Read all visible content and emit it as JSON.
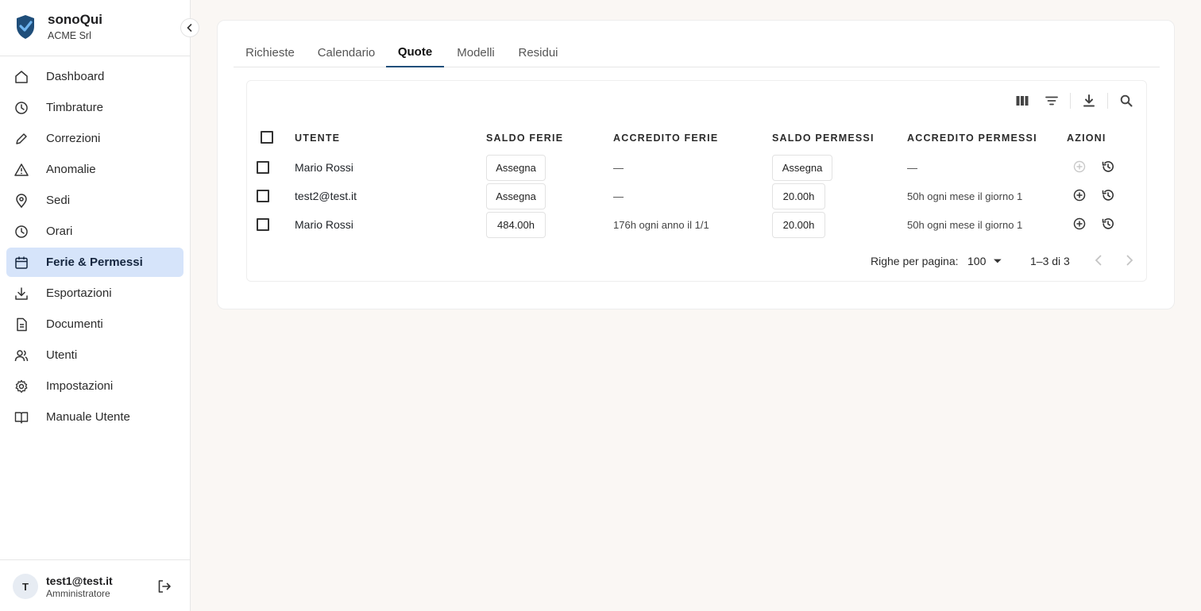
{
  "brand": {
    "name": "sonoQui",
    "org": "ACME Srl"
  },
  "sidebar": {
    "items": [
      {
        "label": "Dashboard",
        "icon": "home-icon"
      },
      {
        "label": "Timbrature",
        "icon": "clock-icon"
      },
      {
        "label": "Correzioni",
        "icon": "pencil-icon"
      },
      {
        "label": "Anomalie",
        "icon": "warning-icon"
      },
      {
        "label": "Sedi",
        "icon": "map-pin-icon"
      },
      {
        "label": "Orari",
        "icon": "clock-icon"
      },
      {
        "label": "Ferie & Permessi",
        "icon": "calendar-icon",
        "active": true
      },
      {
        "label": "Esportazioni",
        "icon": "download-icon"
      },
      {
        "label": "Documenti",
        "icon": "document-icon"
      },
      {
        "label": "Utenti",
        "icon": "users-icon"
      },
      {
        "label": "Impostazioni",
        "icon": "gear-icon"
      },
      {
        "label": "Manuale Utente",
        "icon": "book-icon"
      }
    ]
  },
  "user": {
    "initial": "T",
    "email": "test1@test.it",
    "role": "Amministratore"
  },
  "tabs": [
    {
      "label": "Richieste"
    },
    {
      "label": "Calendario"
    },
    {
      "label": "Quote",
      "active": true
    },
    {
      "label": "Modelli"
    },
    {
      "label": "Residui"
    }
  ],
  "table": {
    "headers": {
      "utente": "UTENTE",
      "saldo_ferie": "SALDO FERIE",
      "accredito_ferie": "ACCREDITO FERIE",
      "saldo_permessi": "SALDO PERMESSI",
      "accredito_permessi": "ACCREDITO PERMESSI",
      "azioni": "AZIONI"
    },
    "rows": [
      {
        "utente": "Mario Rossi",
        "saldo_ferie": "Assegna",
        "accredito_ferie": "—",
        "saldo_permessi": "Assegna",
        "accredito_permessi": "—",
        "accredit_action_enabled": false
      },
      {
        "utente": "test2@test.it",
        "saldo_ferie": "Assegna",
        "accredito_ferie": "—",
        "saldo_permessi": "20.00h",
        "accredito_permessi": "50h ogni mese il giorno 1",
        "accredit_action_enabled": true
      },
      {
        "utente": "Mario Rossi",
        "saldo_ferie": "484.00h",
        "accredito_ferie": "176h ogni anno il 1/1",
        "saldo_permessi": "20.00h",
        "accredito_permessi": "50h ogni mese il giorno 1",
        "accredit_action_enabled": true
      }
    ]
  },
  "pagination": {
    "label": "Righe per pagina:",
    "rows_per_page": "100",
    "range": "1–3 di 3"
  },
  "colors": {
    "accent": "#1f4e7a",
    "active_nav_bg": "#d6e4fa",
    "logo": "#1f4e7a"
  }
}
